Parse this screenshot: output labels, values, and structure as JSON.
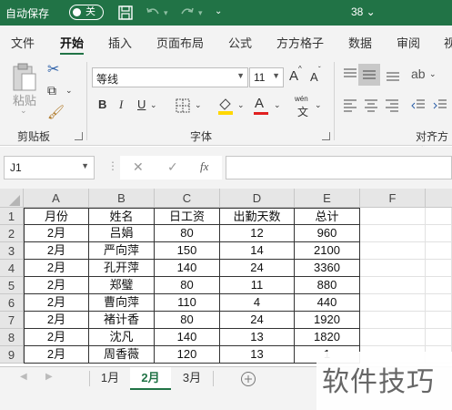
{
  "titlebar": {
    "autosave": "自动保存",
    "toggle_state": "关",
    "doc_title": "38 ⌄"
  },
  "tabs": [
    "文件",
    "开始",
    "插入",
    "页面布局",
    "公式",
    "方方格子",
    "数据",
    "审阅",
    "视"
  ],
  "ribbon": {
    "clipboard": {
      "paste": "粘贴",
      "label": "剪贴板"
    },
    "font": {
      "name": "等线",
      "size": "11",
      "label": "字体",
      "bold": "B",
      "italic": "I",
      "underline": "U",
      "grow": "A",
      "shrink": "A",
      "wen": "wén",
      "wen_char": "文"
    },
    "align_label": "对齐方式"
  },
  "formula": {
    "namebox": "J1",
    "fx": "fx",
    "cancel": "✕",
    "confirm": "✓"
  },
  "colors": {
    "accent": "#217346",
    "font_red": "#e02020",
    "fill_yellow": "#ffd700"
  },
  "columns": [
    "A",
    "B",
    "C",
    "D",
    "E",
    "F"
  ],
  "rows": [
    "1",
    "2",
    "3",
    "4",
    "5",
    "6",
    "7",
    "8",
    "9"
  ],
  "table": {
    "headers": [
      "月份",
      "姓名",
      "日工资",
      "出勤天数",
      "总计"
    ],
    "data": [
      [
        "2月",
        "吕娟",
        "80",
        "12",
        "960"
      ],
      [
        "2月",
        "严向萍",
        "150",
        "14",
        "2100"
      ],
      [
        "2月",
        "孔开萍",
        "140",
        "24",
        "3360"
      ],
      [
        "2月",
        "郑璧",
        "80",
        "11",
        "880"
      ],
      [
        "2月",
        "曹向萍",
        "110",
        "4",
        "440"
      ],
      [
        "2月",
        "褚计香",
        "80",
        "24",
        "1920"
      ],
      [
        "2月",
        "沈凡",
        "140",
        "13",
        "1820"
      ],
      [
        "2月",
        "周香薇",
        "120",
        "13",
        "1"
      ]
    ]
  },
  "sheets": [
    "1月",
    "2月",
    "3月"
  ],
  "watermark": "软件技巧"
}
